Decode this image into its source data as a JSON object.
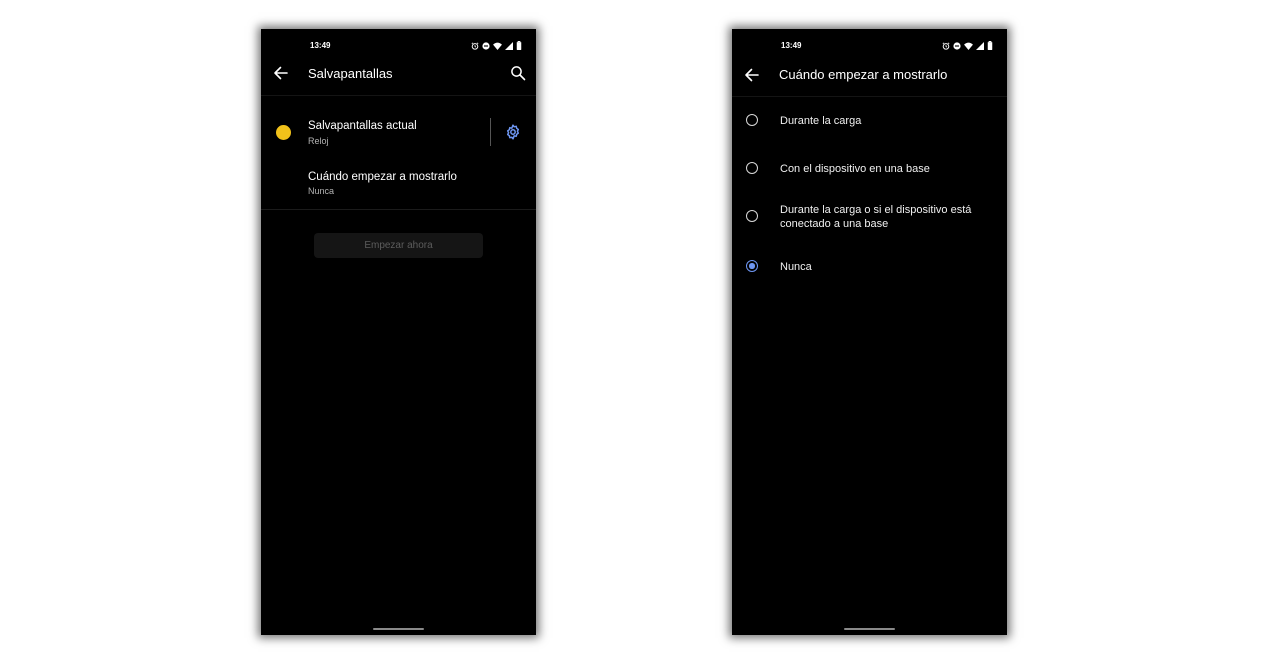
{
  "left_screen": {
    "status": {
      "time": "13:49"
    },
    "title": "Salvapantallas",
    "items": [
      {
        "title": "Salvapantallas actual",
        "subtitle": "Reloj"
      },
      {
        "title": "Cuándo empezar a mostrarlo",
        "subtitle": "Nunca"
      }
    ],
    "start_button": "Empezar ahora"
  },
  "right_screen": {
    "status": {
      "time": "13:49"
    },
    "title": "Cuándo empezar a mostrarlo",
    "options": [
      {
        "label": "Durante la carga",
        "selected": false
      },
      {
        "label": "Con el dispositivo en una base",
        "selected": false
      },
      {
        "label": "Durante la carga o si el dispositivo está conectado a una base",
        "selected": false
      },
      {
        "label": "Nunca",
        "selected": true
      }
    ]
  },
  "colors": {
    "accent": "#6e96f2",
    "screensaver_dot": "#f2c21a",
    "background": "#000000"
  }
}
